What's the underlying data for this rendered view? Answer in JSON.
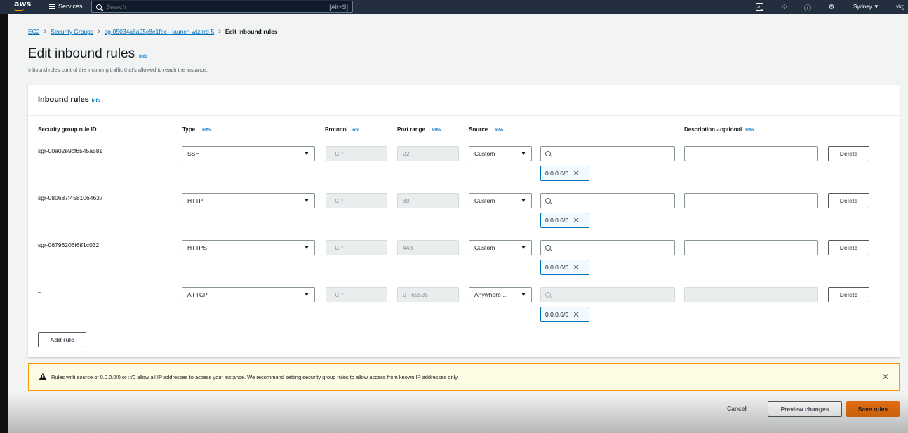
{
  "topnav": {
    "logo": "aws",
    "services_label": "Services",
    "search_placeholder": "Search",
    "search_shortcut": "[Alt+S]",
    "region": "Sydney ▼",
    "account": "vkg"
  },
  "breadcrumb": {
    "items": [
      "EC2",
      "Security Groups",
      "sg-05034a8a95c8e1fbc - launch-wizard-5"
    ],
    "current": "Edit inbound rules"
  },
  "page": {
    "title": "Edit inbound rules",
    "info": "Info",
    "subtitle": "Inbound rules control the incoming traffic that's allowed to reach the instance."
  },
  "panel": {
    "title": "Inbound rules",
    "info": "Info",
    "columns": {
      "rule_id": "Security group rule ID",
      "type": "Type",
      "protocol": "Protocol",
      "port_range": "Port range",
      "source": "Source",
      "description": "Description - optional",
      "info": "Info"
    }
  },
  "rules": [
    {
      "id": "sgr-00a02e9cf6545a581",
      "type": "SSH",
      "protocol": "TCP",
      "port": "22",
      "source": "Custom",
      "cidr": "0.0.0.0/0",
      "delete": "Delete"
    },
    {
      "id": "sgr-080687f4581064637",
      "type": "HTTP",
      "protocol": "TCP",
      "port": "80",
      "source": "Custom",
      "cidr": "0.0.0.0/0",
      "delete": "Delete"
    },
    {
      "id": "sgr-06796206f6ff1c032",
      "type": "HTTPS",
      "protocol": "TCP",
      "port": "443",
      "source": "Custom",
      "cidr": "0.0.0.0/0",
      "delete": "Delete"
    },
    {
      "id": "–",
      "type": "All TCP",
      "protocol": "TCP",
      "port": "0 - 65535",
      "source": "Anywhere-...",
      "cidr": "0.0.0.0/0",
      "delete": "Delete"
    }
  ],
  "add_rule": "Add rule",
  "warning": {
    "text": "Rules with source of 0.0.0.0/0 or ::/0 allow all IP addresses to access your instance. We recommend setting security group rules to allow access from known IP addresses only."
  },
  "footer": {
    "cancel": "Cancel",
    "preview": "Preview changes",
    "save": "Save rules"
  },
  "colors": {
    "nav_bg": "#232f3e",
    "link": "#0073bb",
    "primary": "#ec7211",
    "warning_border": "#ff9900"
  }
}
